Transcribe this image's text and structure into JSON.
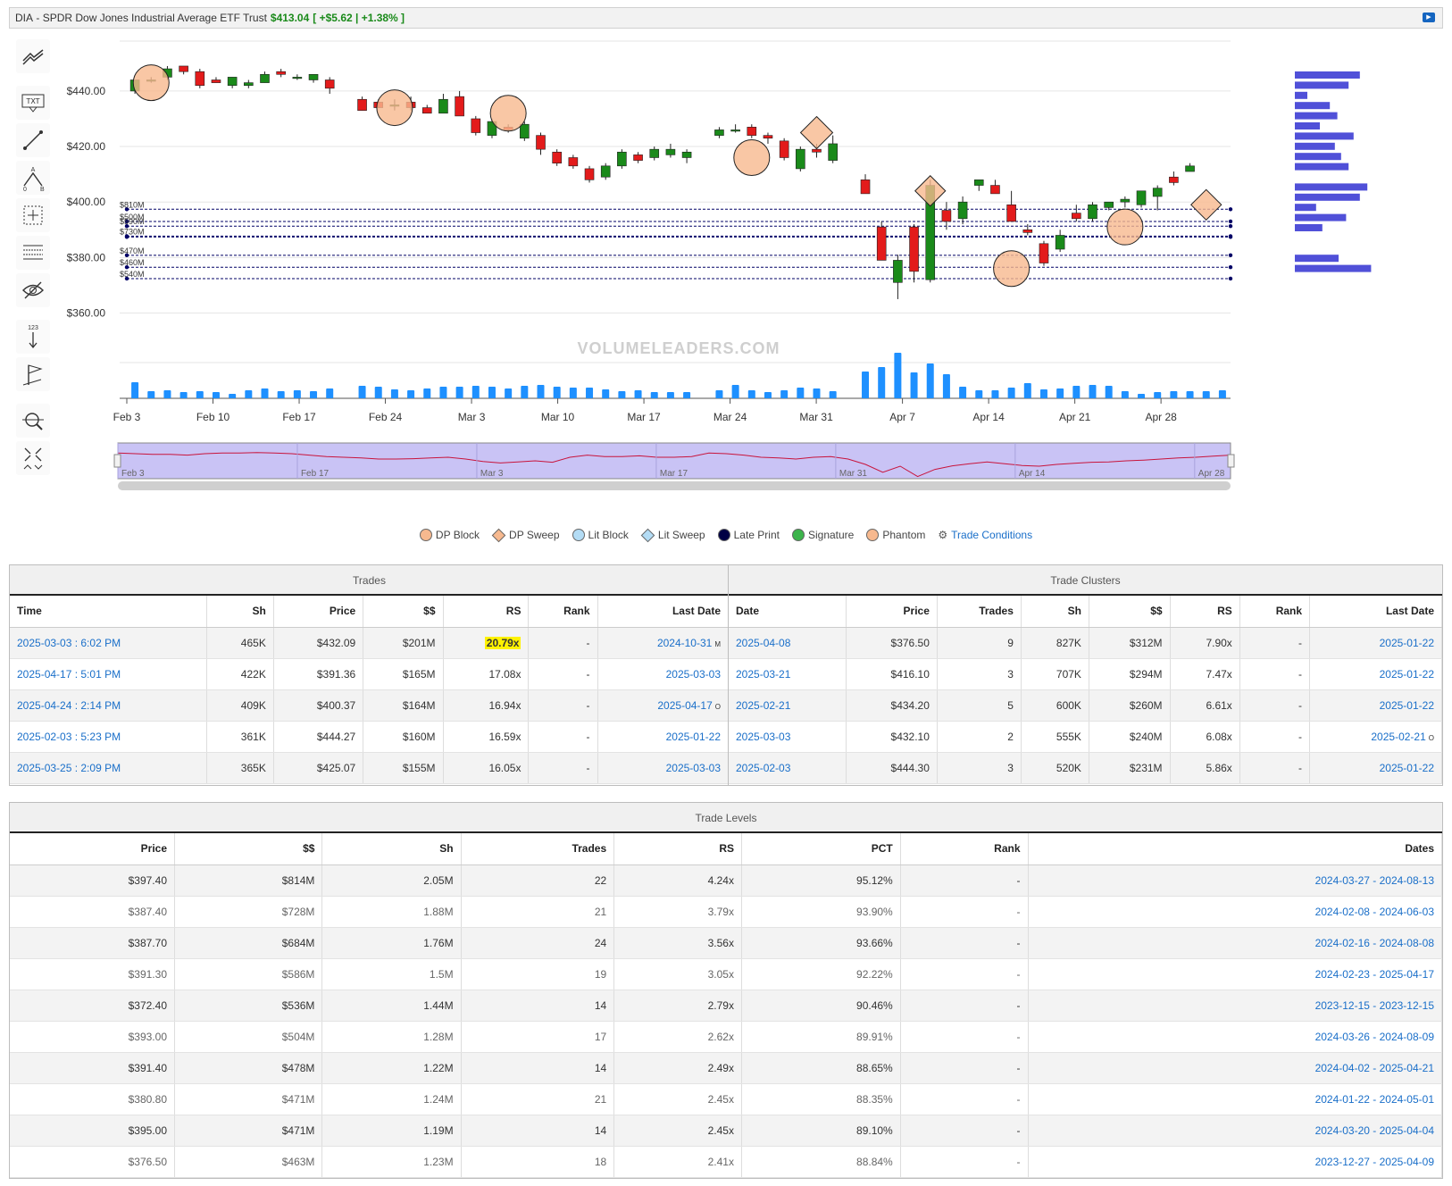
{
  "title": {
    "symbol": "DIA",
    "name": "SPDR Dow Jones Industrial Average ETF Trust",
    "price": "$413.04",
    "change": "[ +$5.62 | +1.38% ]"
  },
  "tools": [
    "trend-icon",
    "text-icon",
    "line-icon",
    "abc-icon",
    "crosshair-icon",
    "fib-icon",
    "hide-icon",
    "numbered-icon",
    "flag-icon",
    "zoom-icon",
    "expand-icon"
  ],
  "tool_labels": {
    "text": "TXT",
    "num": "123"
  },
  "chart_data": {
    "type": "candlestick",
    "watermark": "VOLUMELEADERS.COM",
    "y_ticks": [
      "$440.00",
      "$420.00",
      "$400.00",
      "$380.00",
      "$360.00"
    ],
    "y_range": [
      355,
      458
    ],
    "x_ticks": [
      "Feb 3",
      "Feb 10",
      "Feb 17",
      "Feb 24",
      "Mar 3",
      "Mar 10",
      "Mar 17",
      "Mar 24",
      "Mar 31",
      "Apr 7",
      "Apr 14",
      "Apr 21",
      "Apr 28"
    ],
    "navigator_ticks": [
      "Feb 3",
      "Feb 17",
      "Mar 3",
      "Mar 17",
      "Mar 31",
      "Apr 14",
      "Apr 28"
    ],
    "level_lines": [
      {
        "label": "$810M",
        "price": 397.4
      },
      {
        "label": "$500M",
        "price": 393.0
      },
      {
        "label": "$590M",
        "price": 391.3
      },
      {
        "label": "$730M",
        "price": 387.7
      },
      {
        "label": "",
        "price": 387.4
      },
      {
        "label": "$470M",
        "price": 380.8
      },
      {
        "label": "$460M",
        "price": 376.5
      },
      {
        "label": "$540M",
        "price": 372.4
      }
    ],
    "candles": [
      {
        "o": 440,
        "h": 443,
        "l": 439,
        "c": 444
      },
      {
        "o": 444,
        "h": 445,
        "l": 443,
        "c": 444
      },
      {
        "o": 445,
        "h": 449,
        "l": 444,
        "c": 448
      },
      {
        "o": 449,
        "h": 449,
        "l": 446,
        "c": 447
      },
      {
        "o": 447,
        "h": 448,
        "l": 441,
        "c": 442
      },
      {
        "o": 444,
        "h": 445,
        "l": 443,
        "c": 443
      },
      {
        "o": 442,
        "h": 445,
        "l": 441,
        "c": 445
      },
      {
        "o": 442,
        "h": 444,
        "l": 441,
        "c": 443
      },
      {
        "o": 443,
        "h": 447,
        "l": 443,
        "c": 446
      },
      {
        "o": 447,
        "h": 448,
        "l": 445,
        "c": 446
      },
      {
        "o": 445,
        "h": 446,
        "l": 444,
        "c": 445
      },
      {
        "o": 444,
        "h": 446,
        "l": 443,
        "c": 446
      },
      {
        "o": 444,
        "h": 445,
        "l": 439,
        "c": 441
      },
      {
        "o": 437,
        "h": 438,
        "l": 433,
        "c": 433
      },
      {
        "o": 436,
        "h": 437,
        "l": 434,
        "c": 434
      },
      {
        "o": 435,
        "h": 437,
        "l": 433,
        "c": 435
      },
      {
        "o": 436,
        "h": 438,
        "l": 433,
        "c": 434
      },
      {
        "o": 434,
        "h": 435,
        "l": 432,
        "c": 432
      },
      {
        "o": 432,
        "h": 439,
        "l": 432,
        "c": 437
      },
      {
        "o": 438,
        "h": 440,
        "l": 432,
        "c": 431
      },
      {
        "o": 430,
        "h": 431,
        "l": 424,
        "c": 425
      },
      {
        "o": 424,
        "h": 430,
        "l": 423,
        "c": 429
      },
      {
        "o": 427,
        "h": 428,
        "l": 425,
        "c": 426
      },
      {
        "o": 423,
        "h": 429,
        "l": 422,
        "c": 428
      },
      {
        "o": 424,
        "h": 425,
        "l": 417,
        "c": 419
      },
      {
        "o": 418,
        "h": 419,
        "l": 413,
        "c": 414
      },
      {
        "o": 416,
        "h": 417,
        "l": 412,
        "c": 413
      },
      {
        "o": 412,
        "h": 413,
        "l": 407,
        "c": 408
      },
      {
        "o": 409,
        "h": 414,
        "l": 408,
        "c": 413
      },
      {
        "o": 413,
        "h": 419,
        "l": 412,
        "c": 418
      },
      {
        "o": 417,
        "h": 418,
        "l": 414,
        "c": 415
      },
      {
        "o": 416,
        "h": 420,
        "l": 415,
        "c": 419
      },
      {
        "o": 417,
        "h": 421,
        "l": 416,
        "c": 419
      },
      {
        "o": 416,
        "h": 419,
        "l": 414,
        "c": 418
      },
      {
        "o": 424,
        "h": 427,
        "l": 423,
        "c": 426
      },
      {
        "o": 426,
        "h": 428,
        "l": 425,
        "c": 426
      },
      {
        "o": 427,
        "h": 428,
        "l": 423,
        "c": 424
      },
      {
        "o": 424,
        "h": 425,
        "l": 421,
        "c": 423
      },
      {
        "o": 422,
        "h": 423,
        "l": 415,
        "c": 416
      },
      {
        "o": 412,
        "h": 420,
        "l": 411,
        "c": 419
      },
      {
        "o": 419,
        "h": 421,
        "l": 416,
        "c": 418
      },
      {
        "o": 415,
        "h": 424,
        "l": 414,
        "c": 421
      },
      {
        "o": 408,
        "h": 410,
        "l": 403,
        "c": 403
      },
      {
        "o": 391,
        "h": 393,
        "l": 379,
        "c": 379
      },
      {
        "o": 371,
        "h": 381,
        "l": 365,
        "c": 379
      },
      {
        "o": 391,
        "h": 392,
        "l": 371,
        "c": 375
      },
      {
        "o": 372,
        "h": 408,
        "l": 371,
        "c": 406
      },
      {
        "o": 397,
        "h": 400,
        "l": 390,
        "c": 393
      },
      {
        "o": 394,
        "h": 402,
        "l": 392,
        "c": 400
      },
      {
        "o": 406,
        "h": 408,
        "l": 404,
        "c": 408
      },
      {
        "o": 406,
        "h": 408,
        "l": 403,
        "c": 403
      },
      {
        "o": 399,
        "h": 404,
        "l": 395,
        "c": 393
      },
      {
        "o": 390,
        "h": 392,
        "l": 388,
        "c": 389
      },
      {
        "o": 385,
        "h": 386,
        "l": 377,
        "c": 378
      },
      {
        "o": 383,
        "h": 390,
        "l": 382,
        "c": 388
      },
      {
        "o": 396,
        "h": 399,
        "l": 393,
        "c": 394
      },
      {
        "o": 394,
        "h": 400,
        "l": 393,
        "c": 399
      },
      {
        "o": 398,
        "h": 400,
        "l": 397,
        "c": 400
      },
      {
        "o": 400,
        "h": 402,
        "l": 398,
        "c": 401
      },
      {
        "o": 399,
        "h": 404,
        "l": 398,
        "c": 404
      },
      {
        "o": 402,
        "h": 406,
        "l": 397,
        "c": 405
      },
      {
        "o": 409,
        "h": 411,
        "l": 406,
        "c": 407
      },
      {
        "o": 411,
        "h": 414,
        "l": 411,
        "c": 413
      }
    ],
    "candle_days": [
      0,
      1,
      2,
      3,
      4,
      5,
      6,
      7,
      8,
      9,
      10,
      11,
      12,
      14,
      15,
      16,
      17,
      18,
      19,
      20,
      21,
      22,
      23,
      24,
      25,
      26,
      27,
      28,
      29,
      30,
      31,
      32,
      33,
      34,
      36,
      37,
      38,
      39,
      40,
      41,
      42,
      43,
      45,
      46,
      47,
      48,
      49,
      50,
      51,
      52,
      53,
      54,
      55,
      56,
      57,
      58,
      59,
      60,
      61,
      62,
      63,
      64,
      65
    ],
    "volumes": [
      18,
      8,
      9,
      7,
      8,
      7,
      5,
      9,
      11,
      8,
      9,
      8,
      11,
      14,
      13,
      10,
      9,
      11,
      13,
      13,
      14,
      13,
      11,
      14,
      15,
      13,
      12,
      12,
      10,
      8,
      9,
      7,
      7,
      7,
      9,
      15,
      9,
      7,
      9,
      12,
      11,
      8,
      30,
      35,
      51,
      29,
      39,
      27,
      13,
      9,
      9,
      12,
      17,
      10,
      11,
      14,
      15,
      14,
      8,
      5,
      7,
      8,
      8,
      8,
      9
    ],
    "markers": [
      {
        "type": "DP Block",
        "day": 1,
        "price": 443,
        "size": 20
      },
      {
        "type": "DP Block",
        "day": 16,
        "price": 434,
        "size": 20
      },
      {
        "type": "DP Block",
        "day": 23,
        "price": 432,
        "size": 20
      },
      {
        "type": "DP Block",
        "day": 38,
        "price": 416,
        "size": 20
      },
      {
        "type": "DP Sweep",
        "day": 42,
        "price": 425,
        "size": 18
      },
      {
        "type": "DP Sweep",
        "day": 49,
        "price": 404,
        "size": 17
      },
      {
        "type": "DP Block",
        "day": 54,
        "price": 376,
        "size": 20
      },
      {
        "type": "DP Block",
        "day": 61,
        "price": 391,
        "size": 20
      },
      {
        "type": "DP Sweep",
        "day": 66,
        "price": 399,
        "size": 17
      }
    ],
    "navigator_line": [
      0.72,
      0.7,
      0.68,
      0.68,
      0.66,
      0.7,
      0.72,
      0.72,
      0.73,
      0.72,
      0.7,
      0.66,
      0.62,
      0.6,
      0.58,
      0.55,
      0.55,
      0.56,
      0.58,
      0.6,
      0.55,
      0.48,
      0.44,
      0.47,
      0.5,
      0.46,
      0.6,
      0.66,
      0.62,
      0.62,
      0.64,
      0.6,
      0.6,
      0.62,
      0.72,
      0.7,
      0.66,
      0.6,
      0.58,
      0.55,
      0.6,
      0.62,
      0.55,
      0.4,
      0.18,
      0.35,
      0.06,
      0.26,
      0.36,
      0.42,
      0.47,
      0.42,
      0.37,
      0.35,
      0.4,
      0.43,
      0.46,
      0.47,
      0.5,
      0.52,
      0.55,
      0.58,
      0.6,
      0.63,
      0.66
    ],
    "volume_profile": [
      52,
      43,
      10,
      28,
      34,
      20,
      47,
      32,
      37,
      43,
      0,
      58,
      52,
      17,
      41,
      22,
      0,
      0,
      35,
      61
    ],
    "colors": {
      "up": "#1a8a1a",
      "down": "#e31b1b",
      "volume": "#1e90ff",
      "level": "#000066",
      "marker": "#f7b98f",
      "profile": "#5050d8",
      "navigator": "#c9c3f5"
    }
  },
  "legend": [
    {
      "label": "DP Block",
      "shape": "circle",
      "color": "#f7b98f"
    },
    {
      "label": "DP Sweep",
      "shape": "diamond",
      "color": "#f7b98f"
    },
    {
      "label": "Lit Block",
      "shape": "circle",
      "color": "#b3dcf5"
    },
    {
      "label": "Lit Sweep",
      "shape": "diamond",
      "color": "#b3dcf5"
    },
    {
      "label": "Late Print",
      "shape": "circle",
      "color": "#000044"
    },
    {
      "label": "Signature",
      "shape": "circle",
      "color": "#3cb44b"
    },
    {
      "label": "Phantom",
      "shape": "circle",
      "color": "#f7b98f"
    },
    {
      "label": "Trade Conditions",
      "shape": "link",
      "color": "#1a6fc9"
    }
  ],
  "trades": {
    "title": "Trades",
    "columns": [
      "Time",
      "Sh",
      "Price",
      "$$",
      "RS",
      "Rank",
      "Last Date"
    ],
    "rows": [
      [
        "2025-03-03 : 6:02 PM",
        "465K",
        "$432.09",
        "$201M",
        "20.79x",
        "-",
        "2024-10-31",
        "M"
      ],
      [
        "2025-04-17 : 5:01 PM",
        "422K",
        "$391.36",
        "$165M",
        "17.08x",
        "-",
        "2025-03-03",
        ""
      ],
      [
        "2025-04-24 : 2:14 PM",
        "409K",
        "$400.37",
        "$164M",
        "16.94x",
        "-",
        "2025-04-17",
        "O"
      ],
      [
        "2025-02-03 : 5:23 PM",
        "361K",
        "$444.27",
        "$160M",
        "16.59x",
        "-",
        "2025-01-22",
        ""
      ],
      [
        "2025-03-25 : 2:09 PM",
        "365K",
        "$425.07",
        "$155M",
        "16.05x",
        "-",
        "2025-03-03",
        ""
      ]
    ]
  },
  "clusters": {
    "title": "Trade Clusters",
    "columns": [
      "Date",
      "Price",
      "Trades",
      "Sh",
      "$$",
      "RS",
      "Rank",
      "Last Date"
    ],
    "rows": [
      [
        "2025-04-08",
        "$376.50",
        "9",
        "827K",
        "$312M",
        "7.90x",
        "-",
        "2025-01-22",
        ""
      ],
      [
        "2025-03-21",
        "$416.10",
        "3",
        "707K",
        "$294M",
        "7.47x",
        "-",
        "2025-01-22",
        ""
      ],
      [
        "2025-02-21",
        "$434.20",
        "5",
        "600K",
        "$260M",
        "6.61x",
        "-",
        "2025-01-22",
        ""
      ],
      [
        "2025-03-03",
        "$432.10",
        "2",
        "555K",
        "$240M",
        "6.08x",
        "-",
        "2025-02-21",
        "O"
      ],
      [
        "2025-02-03",
        "$444.30",
        "3",
        "520K",
        "$231M",
        "5.86x",
        "-",
        "2025-01-22",
        ""
      ]
    ]
  },
  "levels": {
    "title": "Trade Levels",
    "columns": [
      "Price",
      "$$",
      "Sh",
      "Trades",
      "RS",
      "PCT",
      "Rank",
      "Dates"
    ],
    "rows": [
      [
        "$397.40",
        "$814M",
        "2.05M",
        "22",
        "4.24x",
        "95.12%",
        "-",
        "2024-03-27 - 2024-08-13"
      ],
      [
        "$387.40",
        "$728M",
        "1.88M",
        "21",
        "3.79x",
        "93.90%",
        "-",
        "2024-02-08 - 2024-06-03"
      ],
      [
        "$387.70",
        "$684M",
        "1.76M",
        "24",
        "3.56x",
        "93.66%",
        "-",
        "2024-02-16 - 2024-08-08"
      ],
      [
        "$391.30",
        "$586M",
        "1.5M",
        "19",
        "3.05x",
        "92.22%",
        "-",
        "2024-02-23 - 2025-04-17"
      ],
      [
        "$372.40",
        "$536M",
        "1.44M",
        "14",
        "2.79x",
        "90.46%",
        "-",
        "2023-12-15 - 2023-12-15"
      ],
      [
        "$393.00",
        "$504M",
        "1.28M",
        "17",
        "2.62x",
        "89.91%",
        "-",
        "2024-03-26 - 2024-08-09"
      ],
      [
        "$391.40",
        "$478M",
        "1.22M",
        "14",
        "2.49x",
        "88.65%",
        "-",
        "2024-04-02 - 2025-04-21"
      ],
      [
        "$380.80",
        "$471M",
        "1.24M",
        "21",
        "2.45x",
        "88.35%",
        "-",
        "2024-01-22 - 2024-05-01"
      ],
      [
        "$395.00",
        "$471M",
        "1.19M",
        "14",
        "2.45x",
        "89.10%",
        "-",
        "2024-03-20 - 2025-04-04"
      ],
      [
        "$376.50",
        "$463M",
        "1.23M",
        "18",
        "2.41x",
        "88.84%",
        "-",
        "2023-12-27 - 2025-04-09"
      ]
    ]
  }
}
